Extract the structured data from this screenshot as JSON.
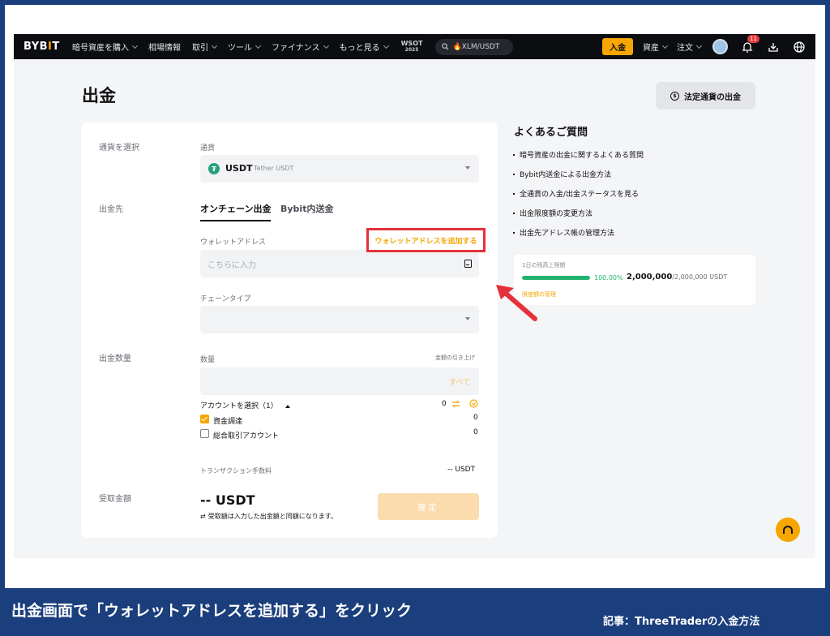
{
  "nav": {
    "logo": "BYBIT",
    "items": [
      {
        "label": "暗号資産を購入",
        "chevron": true
      },
      {
        "label": "相場情報",
        "chevron": false
      },
      {
        "label": "取引",
        "chevron": true
      },
      {
        "label": "ツール",
        "chevron": true
      },
      {
        "label": "ファイナンス",
        "chevron": true
      },
      {
        "label": "もっと見る",
        "chevron": true
      }
    ],
    "wsot_top": "WSOT",
    "wsot_bottom": "2025",
    "search_text": "🔥XLM/USDT",
    "deposit_label": "入金",
    "assets_label": "資産",
    "orders_label": "注文",
    "notification_count": "11"
  },
  "page": {
    "title": "出金",
    "fiat_withdraw_label": "法定通貨の出金"
  },
  "form": {
    "currency_section": "通貨を選択",
    "currency_field_label": "通貨",
    "currency_symbol": "USDT",
    "currency_name": "Tether USDT",
    "destination_section": "出金先",
    "tab_onchain": "オンチェーン出金",
    "tab_internal": "Bybit内送金",
    "wallet_address_label": "ウォレットアドレス",
    "add_wallet_link": "ウォレットアドレスを追加する",
    "address_placeholder": "こちらに入力",
    "chain_type_label": "チェーンタイプ",
    "amount_section": "出金数量",
    "quantity_label": "数量",
    "amount_pullup": "金額の引き上げ",
    "all_button": "すべて",
    "account_select_label": "アカウントを選択（1）",
    "account_select_value": "0",
    "accounts": [
      {
        "label": "資金調達",
        "value": "0",
        "checked": true
      },
      {
        "label": "総合取引アカウント",
        "value": "0",
        "checked": false
      }
    ],
    "fee_label": "トランザクション手数料",
    "fee_value": "-- USDT",
    "receive_section": "受取金額",
    "receive_amount": "-- USDT",
    "receive_note": "受取額は入力した出金額と同額になります。",
    "confirm_label": "確定"
  },
  "faq": {
    "title": "よくあるご質問",
    "items": [
      "暗号資産の出金に関するよくある質問",
      "Bybit内送金による出金方法",
      "全通貨の入金/出金ステータスを見る",
      "出金限度額の変更方法",
      "出金先アドレス帳の管理方法"
    ]
  },
  "limit": {
    "label": "1日の残高上限額",
    "percent_text": "100.00%",
    "fill_fraction": 1.0,
    "used": "2,000,000",
    "total": "/2,000,000 USDT",
    "manage_link": "限度額の管理"
  },
  "annotation": {
    "caption": "出金画面で「ウォレットアドレスを追加する」をクリック",
    "credit": "記事：ThreeTraderの入金方法",
    "highlight_color": "#e5313a"
  },
  "colors": {
    "accent": "#f7a600",
    "success": "#20b26c",
    "banner": "#1b3e7c"
  }
}
